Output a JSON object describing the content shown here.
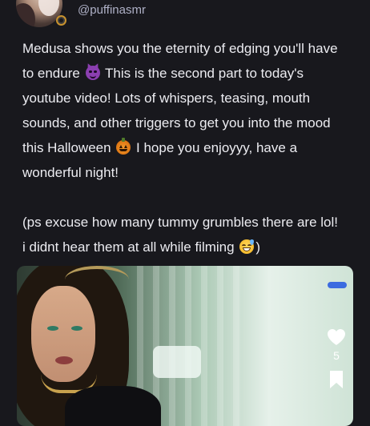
{
  "profile": {
    "username": "@puffinasmr"
  },
  "post": {
    "lines": [
      "Medusa shows you the eternity of edging you'll have",
      "to endure",
      "This is the second part to today's",
      "youtube video! Lots of whispers, teasing, mouth",
      "sounds, and other triggers to get you into the mood",
      "this Halloween",
      "I hope you enjoyyy, have a",
      "wonderful night!",
      "(ps excuse how many tummy grumbles there are lol!",
      "i didnt hear them at all while filming",
      ")"
    ],
    "emojis": {
      "devil": "smiling-devil",
      "pumpkin": "jack-o-lantern",
      "sweat": "sweat-smile"
    }
  },
  "video": {
    "like_count": "5"
  },
  "colors": {
    "background": "#18181d",
    "text": "#ececf1",
    "username": "#aeb0c6",
    "accent": "#3c6be0"
  }
}
